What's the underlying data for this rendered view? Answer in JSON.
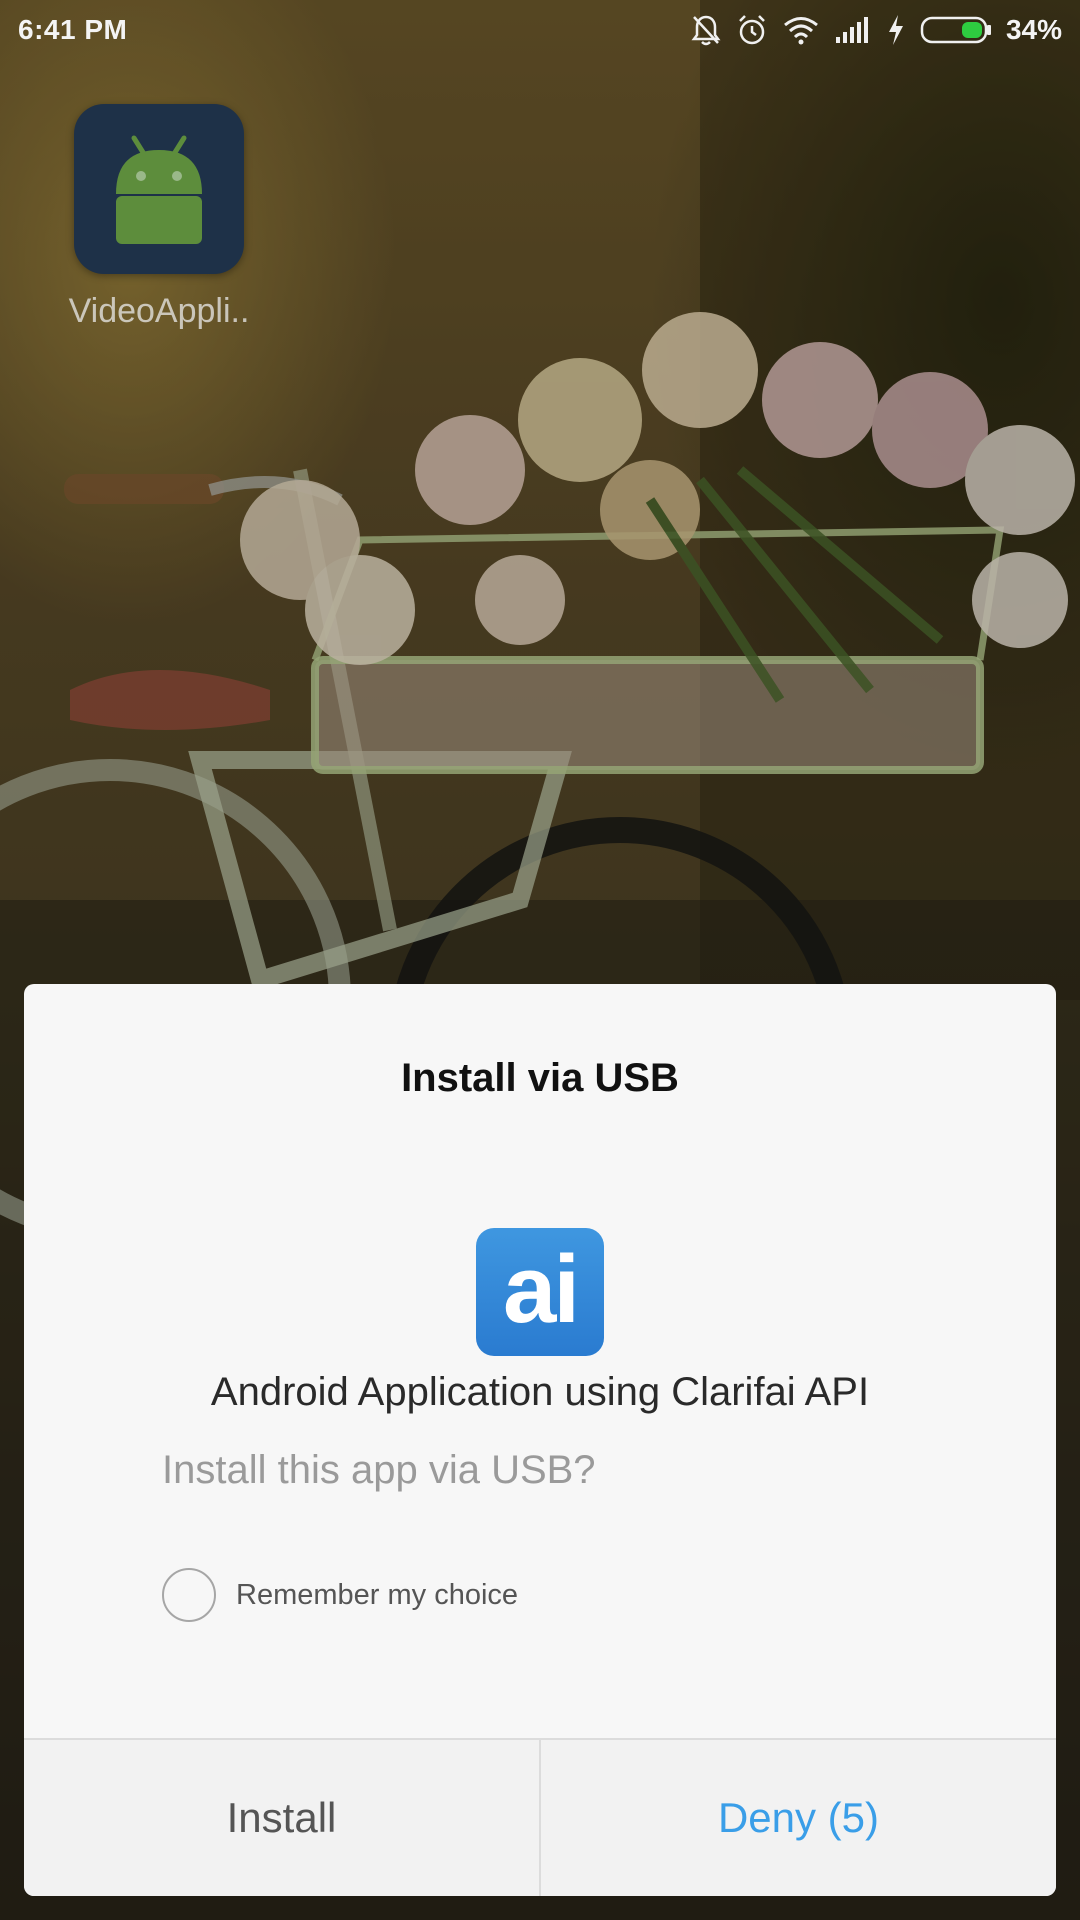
{
  "status_bar": {
    "time": "6:41 PM",
    "icons": [
      "mute-icon",
      "alarm-icon",
      "wifi-icon",
      "signal-icon",
      "charging-icon",
      "battery-icon"
    ],
    "battery_percent": "34%"
  },
  "home": {
    "app_label": "VideoAppli.."
  },
  "dialog": {
    "title": "Install via USB",
    "app_icon_text": "ai",
    "app_name": "Android Application using Clarifai API",
    "question": "Install this app via USB?",
    "remember_label": "Remember my choice",
    "install_label": "Install",
    "deny_label": "Deny (5)"
  },
  "colors": {
    "accent": "#3a9ee8",
    "dialog_bg": "#f7f7f7",
    "app_icon_bg": "#2a7bd0",
    "battery_fill": "#2ecc40"
  }
}
